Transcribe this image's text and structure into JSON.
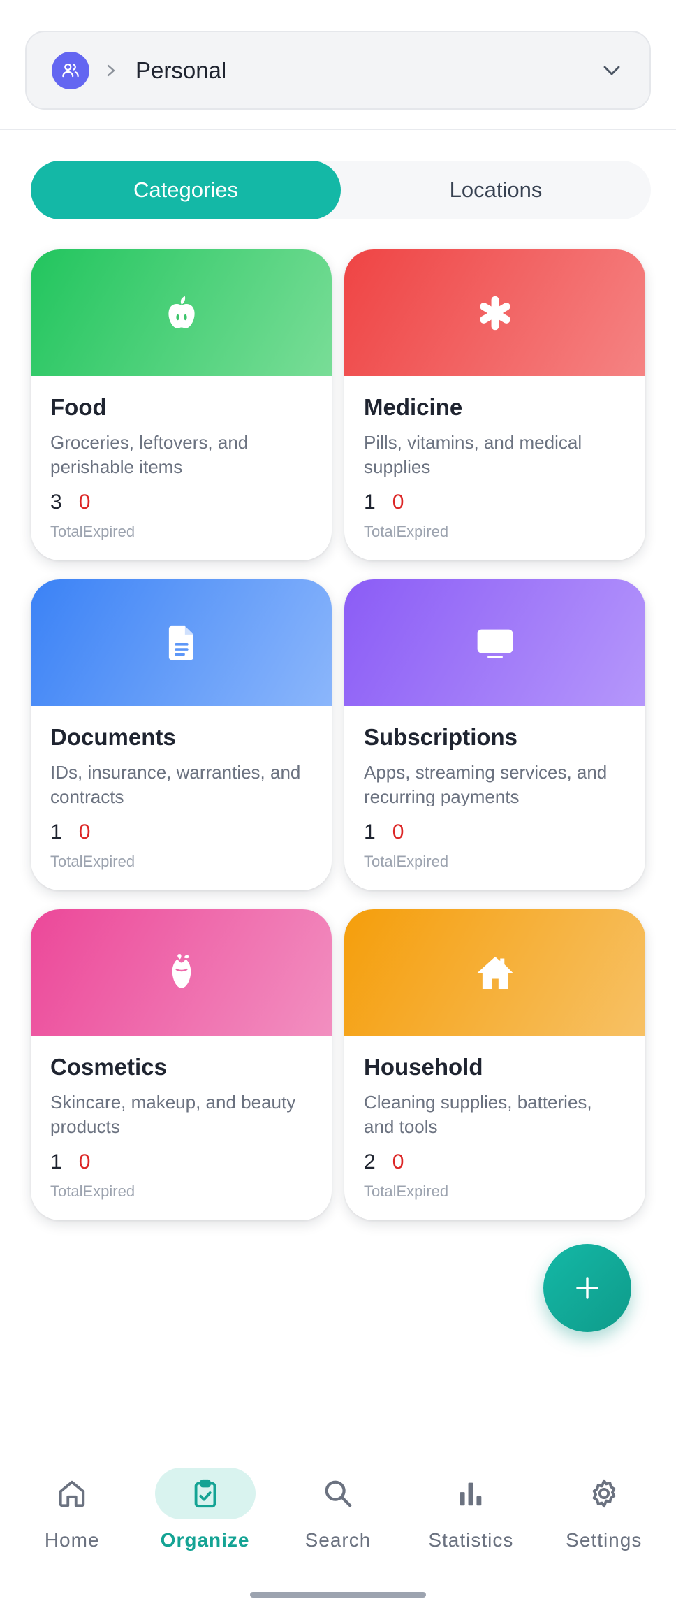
{
  "space_selector": {
    "name": "Personal",
    "avatar_icon": "users-icon",
    "avatar_color": "#6366f1"
  },
  "tabs": {
    "categories_label": "Categories",
    "locations_label": "Locations",
    "active": "Categories"
  },
  "accent_color": "#14b8a6",
  "categories": [
    {
      "title": "Food",
      "description": "Groceries, leftovers, and perishable items",
      "total": "3",
      "expired": "0",
      "total_label": "Total",
      "expired_label": "Expired",
      "icon": "apple-icon",
      "color": "#22c55e"
    },
    {
      "title": "Medicine",
      "description": "Pills, vitamins, and medical supplies",
      "total": "1",
      "expired": "0",
      "total_label": "Total",
      "expired_label": "Expired",
      "icon": "asterisk-icon",
      "color": "#ef4444"
    },
    {
      "title": "Documents",
      "description": "IDs, insurance, warranties, and contracts",
      "total": "1",
      "expired": "0",
      "total_label": "Total",
      "expired_label": "Expired",
      "icon": "document-icon",
      "color": "#3b82f6"
    },
    {
      "title": "Subscriptions",
      "description": "Apps, streaming services, and recurring payments",
      "total": "1",
      "expired": "0",
      "total_label": "Total",
      "expired_label": "Expired",
      "icon": "tv-icon",
      "color": "#8b5cf6"
    },
    {
      "title": "Cosmetics",
      "description": "Skincare, makeup, and beauty products",
      "total": "1",
      "expired": "0",
      "total_label": "Total",
      "expired_label": "Expired",
      "icon": "rose-icon",
      "color": "#ec4899"
    },
    {
      "title": "Household",
      "description": "Cleaning supplies, batteries, and tools",
      "total": "2",
      "expired": "0",
      "total_label": "Total",
      "expired_label": "Expired",
      "icon": "house-icon",
      "color": "#f59e0b"
    }
  ],
  "fab": {
    "icon": "plus-icon"
  },
  "nav": {
    "items": [
      {
        "label": "Home",
        "icon": "home-icon"
      },
      {
        "label": "Organize",
        "icon": "clipboard-check-icon"
      },
      {
        "label": "Search",
        "icon": "search-icon"
      },
      {
        "label": "Statistics",
        "icon": "bar-chart-icon"
      },
      {
        "label": "Settings",
        "icon": "gear-icon"
      }
    ],
    "active": "Organize"
  }
}
